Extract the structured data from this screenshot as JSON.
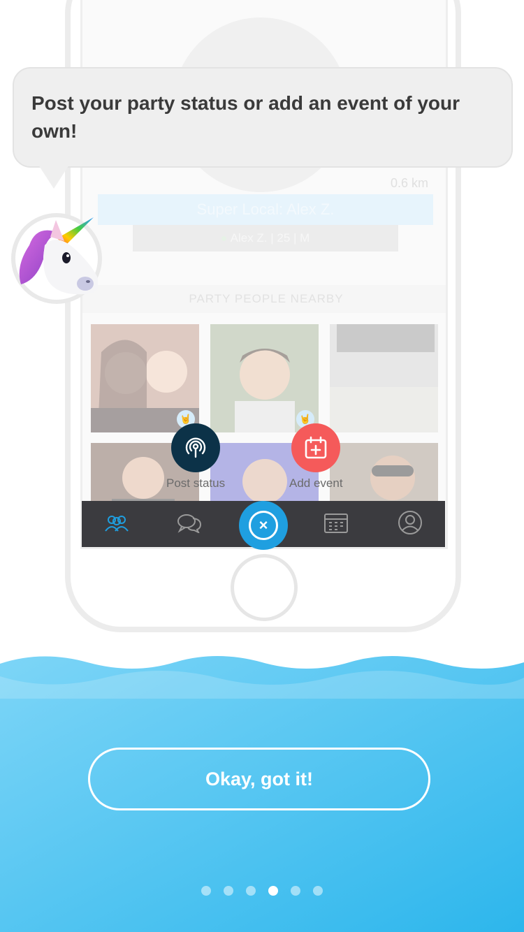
{
  "tooltip": {
    "text": "Post your party status or add an event of your own!"
  },
  "profile": {
    "distance": "0.6 km",
    "banner": "Super Local: Alex Z.",
    "subline": "Alex Z. | 25 | M"
  },
  "section": {
    "nearby_title": "PARTY PEOPLE NEARBY"
  },
  "actions": {
    "post_status": {
      "label": "Post status",
      "icon": "podcast-icon"
    },
    "add_event": {
      "label": "Add event",
      "icon": "calendar-plus-icon"
    }
  },
  "tabbar": {
    "items": [
      {
        "name": "people",
        "icon": "people-icon"
      },
      {
        "name": "chat",
        "icon": "chat-icon"
      },
      {
        "name": "close",
        "icon": "close-icon"
      },
      {
        "name": "calendar",
        "icon": "calendar-icon"
      },
      {
        "name": "profile",
        "icon": "profile-icon"
      }
    ]
  },
  "cta": {
    "label": "Okay, got it!"
  },
  "pager": {
    "count": 6,
    "active_index": 3
  },
  "colors": {
    "accent_blue": "#1f9fe0",
    "status_navy": "#0c3248",
    "event_red": "#f55a5a",
    "water_light": "#7dd5f7",
    "water_dark": "#2db6ec"
  }
}
